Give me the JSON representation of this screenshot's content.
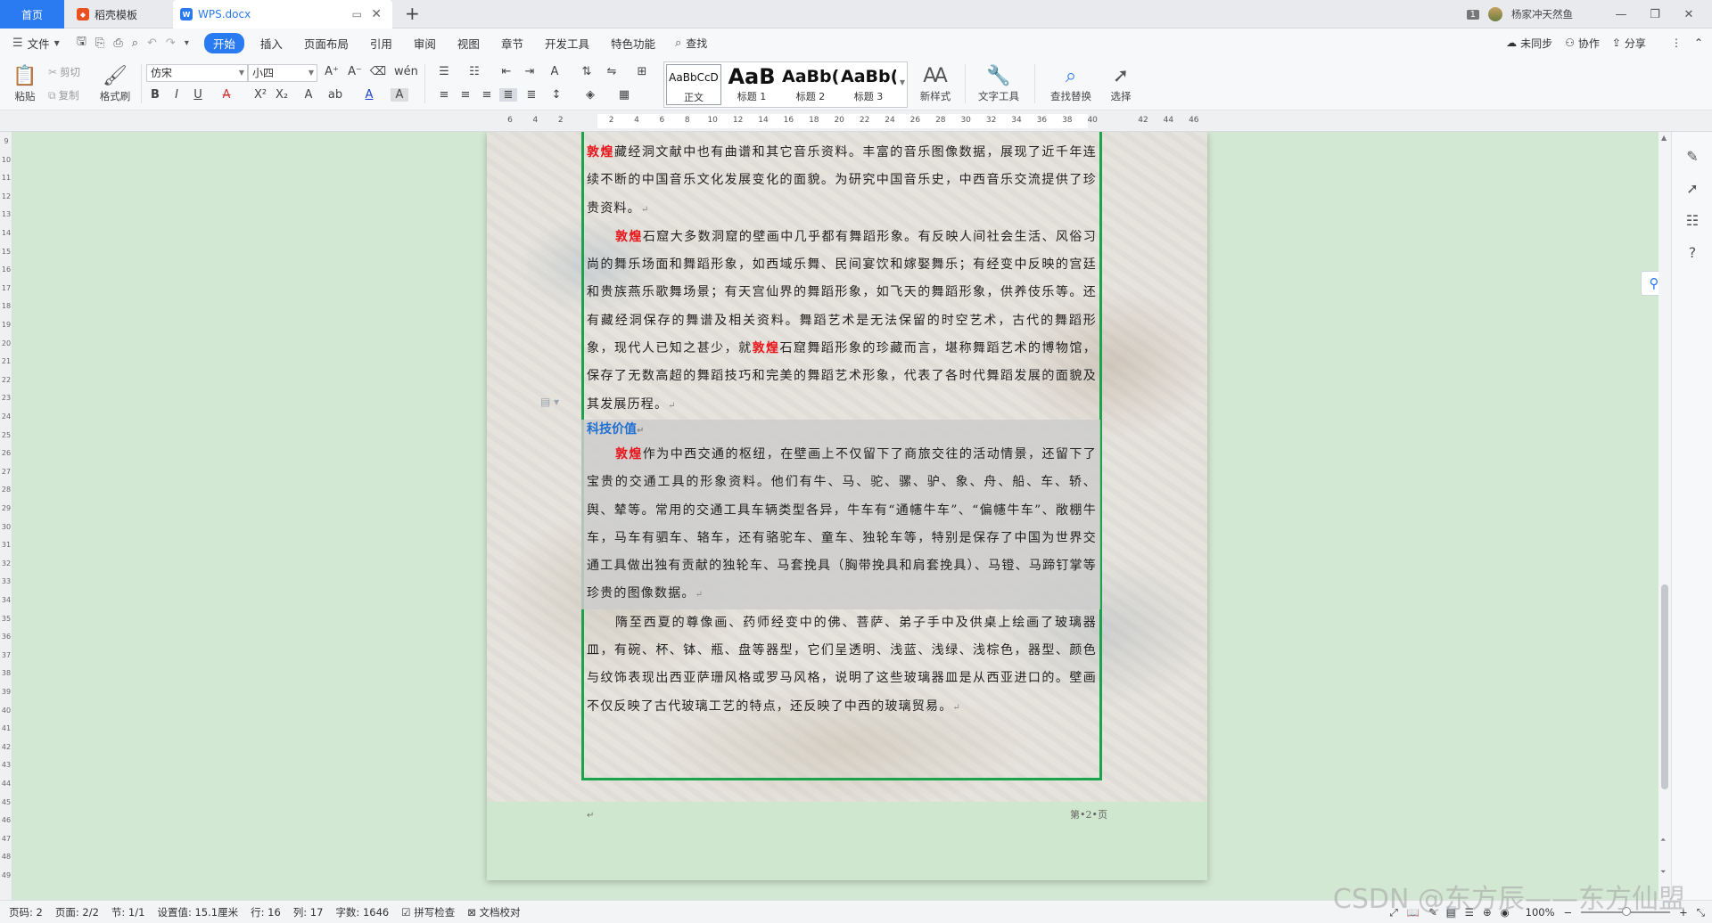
{
  "tabs": {
    "home": "首页",
    "template": "稻壳模板",
    "doc": "WPS.docx"
  },
  "topbar": {
    "badge": "1",
    "username": "杨家冲天然鱼"
  },
  "menu": {
    "file": "文件",
    "items": [
      "开始",
      "插入",
      "页面布局",
      "引用",
      "审阅",
      "视图",
      "章节",
      "开发工具",
      "特色功能"
    ],
    "search": "查找",
    "right": {
      "sync": "未同步",
      "collab": "协作",
      "share": "分享"
    }
  },
  "ribbon": {
    "paste": "粘贴",
    "cut": "剪切",
    "copy": "复制",
    "format_painter": "格式刷",
    "font_name": "仿宋",
    "font_size": "小四",
    "styles": [
      {
        "sample": "AaBbCcD",
        "name": "正文"
      },
      {
        "sample": "AaB",
        "name": "标题 1"
      },
      {
        "sample": "AaBb(",
        "name": "标题 2"
      },
      {
        "sample": "AaBb(",
        "name": "标题 3"
      }
    ],
    "new_style": "新样式",
    "text_tools": "文字工具",
    "find_replace": "查找替换",
    "select": "选择"
  },
  "document": {
    "paragraphs": [
      {
        "red": "敦煌",
        "text": "藏经洞文献中也有曲谱和其它音乐资料。丰富的音乐图像数据，展现了近千年连续不断的中国音乐文化发展变化的面貌。为研究中国音乐史，中西音乐交流提供了珍贵资料。"
      },
      {
        "red": "敦煌",
        "text": "石窟大多数洞窟的壁画中几乎都有舞蹈形象。有反映人间社会生活、风俗习尚的舞乐场面和舞蹈形象，如西域乐舞、民间宴饮和嫁娶舞乐；有经变中反映的宫廷和贵族燕乐歌舞场景；有天宫仙界的舞蹈形象，如飞天的舞蹈形象，供养伎乐等。还有藏经洞保存的舞谱及相关资料。舞蹈艺术是无法保留的时空艺术，古代的舞蹈形象，现代人已知之甚少，就",
        "red2": "敦煌",
        "text2": "石窟舞蹈形象的珍藏而言，堪称舞蹈艺术的博物馆，保存了无数高超的舞蹈技巧和完美的舞蹈艺术形象，代表了各时代舞蹈发展的面貌及其发展历程。"
      }
    ],
    "heading": "科技价值",
    "tech_paragraph": {
      "red": "敦煌",
      "text": "作为中西交通的枢纽，在壁画上不仅留下了商旅交往的活动情景，还留下了宝贵的交通工具的形象资料。他们有牛、马、驼、骡、驴、象、舟、船、车、轿、舆、辇等。常用的交通工具车辆类型各异，牛车有“通幰牛车”、“偏幰牛车”、敞棚牛车，马车有驷车、辂车，还有骆驼车、童车、独轮车等，特别是保存了中国为世界交通工具做出独有贡献的独轮车、马套挽具（胸带挽具和肩套挽具）、马镫、马蹄钉掌等珍贵的图像数据。"
    },
    "last_paragraph": "隋至西夏的尊像画、药师经变中的佛、菩萨、弟子手中及供桌上绘画了玻璃器皿，有碗、杯、钵、瓶、盘等器型，它们呈透明、浅蓝、浅绿、浅棕色，器型、颜色与纹饰表现出西亚萨珊风格或罗马风格，说明了这些玻璃器皿是从西亚进口的。壁画不仅反映了古代玻璃工艺的特点，还反映了中西的玻璃贸易。",
    "para_mark": "↵",
    "footer": "第•2•页"
  },
  "ruler": {
    "h_ticks": [
      "6",
      "4",
      "2",
      "",
      "2",
      "4",
      "6",
      "8",
      "10",
      "12",
      "14",
      "16",
      "18",
      "20",
      "22",
      "24",
      "26",
      "28",
      "30",
      "32",
      "34",
      "36",
      "38",
      "40",
      "",
      "42",
      "44",
      "46"
    ],
    "v_ticks": [
      "9",
      "10",
      "11",
      "12",
      "13",
      "14",
      "15",
      "16",
      "17",
      "18",
      "19",
      "20",
      "21",
      "22",
      "23",
      "24",
      "25",
      "26",
      "27",
      "28",
      "29",
      "30",
      "31",
      "32",
      "33",
      "34",
      "35",
      "36",
      "37",
      "38",
      "39",
      "40",
      "41",
      "42",
      "43",
      "44",
      "45",
      "46",
      "47",
      "48",
      "49"
    ]
  },
  "status": {
    "page_code": "页码: 2",
    "pages": "页面: 2/2",
    "section": "节: 1/1",
    "setting": "设置值: 15.1厘米",
    "row": "行: 16",
    "col": "列: 17",
    "words": "字数: 1646",
    "spell": "拼写检查",
    "proof": "文档校对",
    "zoom": "100%"
  },
  "watermark": "CSDN @东方辰——东方仙盟"
}
